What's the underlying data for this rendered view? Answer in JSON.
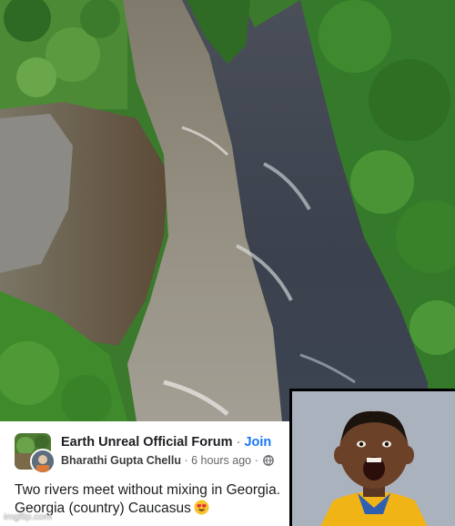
{
  "post": {
    "group_name": "Earth Unreal Official Forum",
    "separator": "·",
    "join_label": "Join",
    "author_name": "Bharathi Gupta Chellu",
    "timestamp": "6 hours ago",
    "privacy_icon": "globe-icon",
    "text": "Two rivers meet without mixing in Georgia. Georgia (country) Caucasus",
    "emoji": "heart-eyes-emoji"
  },
  "watermark": "imgflip.com",
  "colors": {
    "link_blue": "#1877f2",
    "muddy_river": "#8e8a7c",
    "dark_river": "#3f4654",
    "forest_green": "#2f7d2a"
  }
}
